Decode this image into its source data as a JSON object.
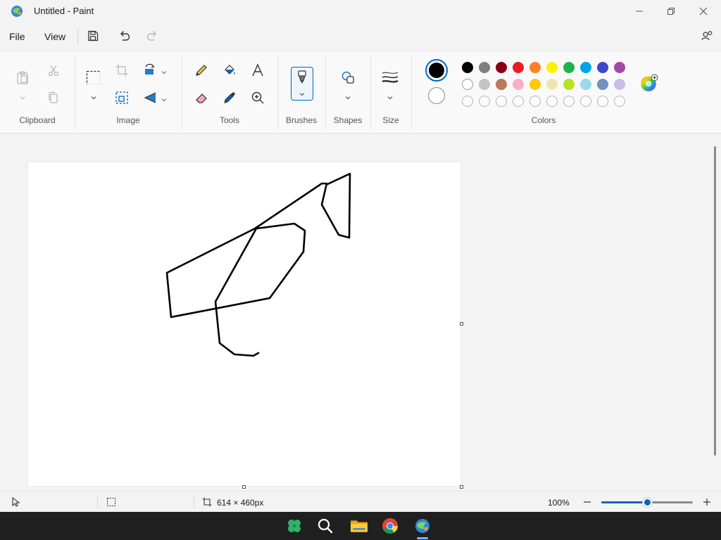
{
  "window": {
    "title": "Untitled - Paint"
  },
  "menu": {
    "file": "File",
    "view": "View"
  },
  "ribbon": {
    "groups": {
      "clipboard": "Clipboard",
      "image": "Image",
      "tools": "Tools",
      "brushes": "Brushes",
      "shapes": "Shapes",
      "size": "Size",
      "colors": "Colors"
    }
  },
  "colors": {
    "primary": "#000000",
    "secondary": "#ffffff",
    "palette_row1": [
      "#000000",
      "#7f7f7f",
      "#880015",
      "#ed1c24",
      "#ff7f27",
      "#fff200",
      "#22b14c",
      "#00a2e8",
      "#3f48cc",
      "#a349a4"
    ],
    "palette_row2": [
      "#ffffff",
      "#c3c3c3",
      "#b97a57",
      "#ffaec9",
      "#ffc90e",
      "#efe4b0",
      "#b5e61d",
      "#99d9ea",
      "#7092be",
      "#c8bfe7"
    ],
    "palette_row3_count": 10,
    "accent": "#0067c0"
  },
  "status": {
    "canvas_size": "614 × 460px",
    "zoom": "100%",
    "zoom_slider": 0.5
  }
}
